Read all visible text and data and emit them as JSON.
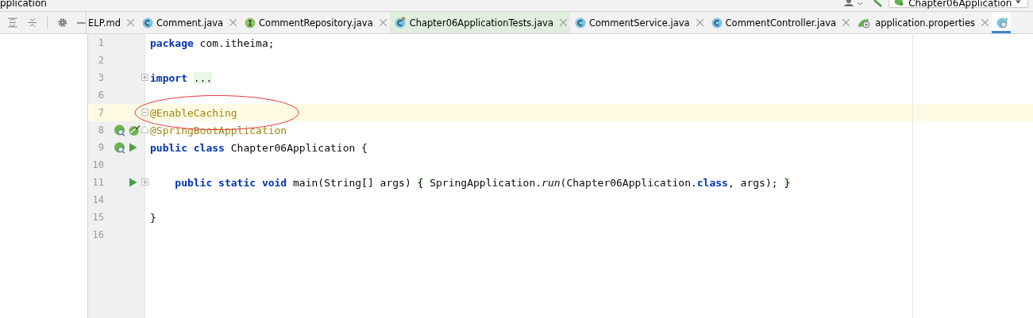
{
  "title_bar": {
    "project": "pplication",
    "run_config": "Chapter06Application"
  },
  "tabs": [
    {
      "label": "ELP.md",
      "kind": "text",
      "selected": false
    },
    {
      "label": "Comment.java",
      "kind": "class",
      "selected": false
    },
    {
      "label": "CommentRepository.java",
      "kind": "interface",
      "selected": false
    },
    {
      "label": "Chapter06ApplicationTests.java",
      "kind": "test",
      "selected": false
    },
    {
      "label": "CommentService.java",
      "kind": "class",
      "selected": false
    },
    {
      "label": "CommentController.java",
      "kind": "class",
      "selected": false
    },
    {
      "label": "application.properties",
      "kind": "props",
      "selected": false
    },
    {
      "kind": "spring",
      "selected": true
    }
  ],
  "code_lines": [
    {
      "number": "1",
      "current": false,
      "tokens": [
        {
          "kind": "keyword",
          "text": "package"
        },
        {
          "kind": "plain",
          "text": " com.itheima;"
        }
      ]
    },
    {
      "number": "2",
      "current": false
    },
    {
      "number": "3",
      "current": false,
      "tokens": [
        {
          "kind": "keyword",
          "text": "import "
        },
        {
          "kind": "folded",
          "text": "..."
        }
      ]
    },
    {
      "number": "6",
      "current": false
    },
    {
      "number": "7",
      "current": true,
      "tokens": [
        {
          "kind": "annotation",
          "text": "@EnableCaching"
        }
      ]
    },
    {
      "number": "8",
      "current": false,
      "tokens": [
        {
          "kind": "annotation",
          "text": "@SpringBootApplication"
        }
      ]
    },
    {
      "number": "9",
      "current": false,
      "tokens": [
        {
          "kind": "keyword",
          "text": "public class"
        },
        {
          "kind": "plain",
          "text": " Chapter06Application {"
        }
      ]
    },
    {
      "number": "10",
      "current": false
    },
    {
      "number": "11",
      "current": false,
      "tokens": [
        {
          "kind": "keyword",
          "text": "    public static void"
        },
        {
          "kind": "plain",
          "text": " main(String[] args) "
        },
        {
          "kind": "folded",
          "text": "{"
        },
        {
          "kind": "plain",
          "text": " SpringApplication."
        },
        {
          "kind": "italic",
          "text": "run"
        },
        {
          "kind": "plain",
          "text": "(Chapter06Application."
        },
        {
          "kind": "keyword",
          "text": "class"
        },
        {
          "kind": "plain",
          "text": ", args); "
        },
        {
          "kind": "folded",
          "text": "}"
        }
      ]
    },
    {
      "number": "14",
      "current": false
    },
    {
      "number": "15",
      "current": false,
      "tokens": [
        {
          "kind": "plain",
          "text": "}"
        }
      ]
    },
    {
      "number": "16",
      "current": false
    }
  ],
  "highlight": {
    "kind": "ellipse"
  }
}
